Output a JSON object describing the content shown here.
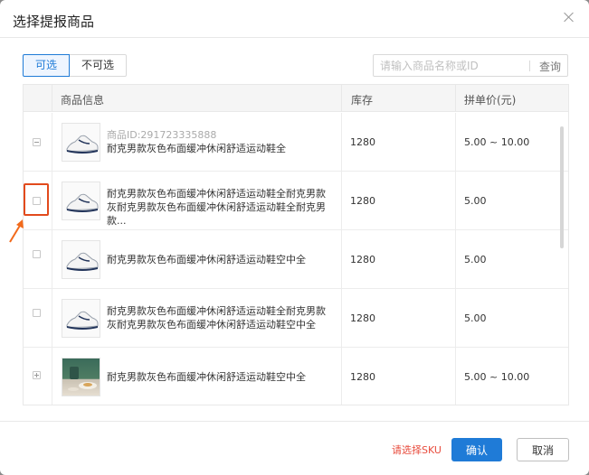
{
  "dialog": {
    "title": "选择提报商品",
    "close_icon": "close-icon"
  },
  "filter_tabs": [
    {
      "label": "可选",
      "active": true
    },
    {
      "label": "不可选",
      "active": false
    }
  ],
  "search": {
    "placeholder": "请输入商品名称或ID",
    "button_label": "查询",
    "value": ""
  },
  "table": {
    "columns": [
      "商品信息",
      "库存",
      "拼单价(元)"
    ],
    "rows": [
      {
        "control": "minus",
        "sku_line": "商品ID:291723335888",
        "name": "耐克男款灰色布面缓冲休闲舒适运动鞋全",
        "stock": "1280",
        "price": "5.00 ~ 10.00",
        "image": "white-sneaker"
      },
      {
        "control": "checkbox",
        "sku_line": "",
        "name": "耐克男款灰色布面缓冲休闲舒适运动鞋全耐克男款灰耐克男款灰色布面缓冲休闲舒适运动鞋全耐克男款...",
        "stock": "1280",
        "price": "5.00",
        "image": "white-sneaker"
      },
      {
        "control": "checkbox",
        "sku_line": "",
        "name": "耐克男款灰色布面缓冲休闲舒适运动鞋空中全",
        "stock": "1280",
        "price": "5.00",
        "image": "white-sneaker"
      },
      {
        "control": "checkbox",
        "sku_line": "",
        "name": "耐克男款灰色布面缓冲休闲舒适运动鞋全耐克男款灰耐克男款灰色布面缓冲休闲舒适运动鞋空中全",
        "stock": "1280",
        "price": "5.00",
        "image": "white-sneaker"
      },
      {
        "control": "plus",
        "sku_line": "",
        "name": "耐克男款灰色布面缓冲休闲舒适运动鞋空中全",
        "stock": "1280",
        "price": "5.00 ~ 10.00",
        "image": "tableware-photo"
      }
    ]
  },
  "footer": {
    "hint": "请选择SKU",
    "confirm_label": "确认",
    "cancel_label": "取消"
  },
  "annotation": {
    "highlight_color": "#e24a1c",
    "arrow_color": "#f26a1b"
  },
  "colors": {
    "primary": "#1f7bd7",
    "warning_text": "#e84c3d"
  }
}
